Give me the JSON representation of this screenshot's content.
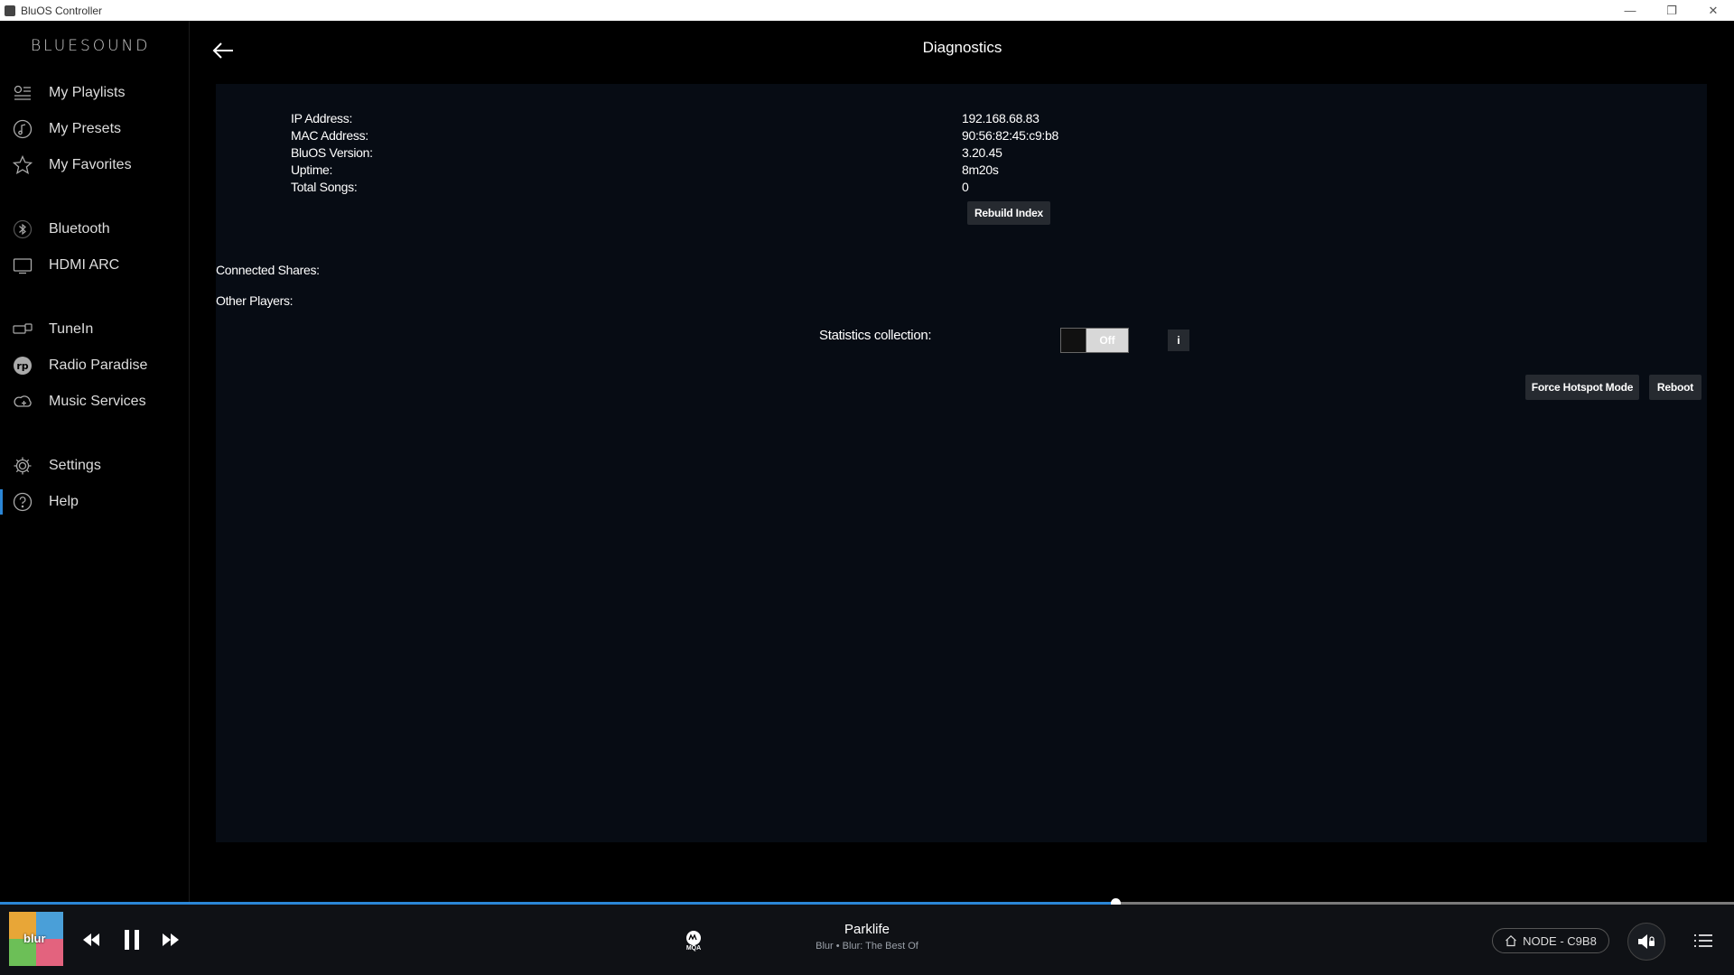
{
  "window": {
    "title": "BluOS Controller",
    "min": "—",
    "restore": "❐",
    "close": "✕"
  },
  "sidebar": {
    "logo": "BLUESOUND",
    "items": [
      {
        "label": "My Playlists",
        "icon": "playlist-icon"
      },
      {
        "label": "My Presets",
        "icon": "preset-icon"
      },
      {
        "label": "My Favorites",
        "icon": "star-icon"
      },
      {
        "label": "Bluetooth",
        "icon": "bluetooth-icon"
      },
      {
        "label": "HDMI ARC",
        "icon": "tv-icon"
      },
      {
        "label": "TuneIn",
        "icon": "tunein-icon"
      },
      {
        "label": "Radio Paradise",
        "icon": "radio-paradise-icon"
      },
      {
        "label": "Music Services",
        "icon": "music-services-icon"
      },
      {
        "label": "Settings",
        "icon": "gear-icon"
      },
      {
        "label": "Help",
        "icon": "help-icon",
        "active": true
      }
    ]
  },
  "header": {
    "title": "Diagnostics"
  },
  "diagnostics": {
    "rows": [
      {
        "label": "IP Address:",
        "value": "192.168.68.83"
      },
      {
        "label": "MAC Address:",
        "value": "90:56:82:45:c9:b8"
      },
      {
        "label": "BluOS Version:",
        "value": "3.20.45"
      },
      {
        "label": "Uptime:",
        "value": "8m20s"
      },
      {
        "label": "Total Songs:",
        "value": "0"
      }
    ],
    "rebuild_index": "Rebuild Index",
    "connected_shares": "Connected Shares:",
    "other_players": "Other Players:",
    "statistics_label": "Statistics collection:",
    "statistics_state": "Off",
    "info_label": "i",
    "force_hotspot": "Force Hotspot Mode",
    "reboot": "Reboot"
  },
  "player": {
    "progress": 0.643,
    "album_text": "blur",
    "track_title": "Parklife",
    "track_sub": "Blur • Blur: The Best Of",
    "mqa_label": "MQA",
    "device": "NODE - C9B8"
  },
  "colors": {
    "accent": "#2b86d6",
    "panel": "#070c14",
    "button": "#262a30"
  }
}
